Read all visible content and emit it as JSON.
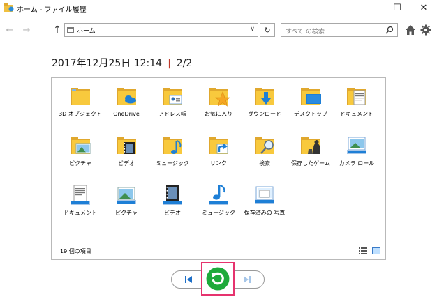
{
  "window": {
    "title": "ホーム - ファイル履歴",
    "minimize": "—",
    "maximize": "☐",
    "close": "✕"
  },
  "nav": {
    "back": "←",
    "forward": "→",
    "up": "↑",
    "address_value": "ホーム",
    "address_dropdown": "∨",
    "refresh": "↻",
    "search_placeholder": "すべて の検索"
  },
  "heading": {
    "datetime": "2017年12月25日 12:14",
    "separator": "|",
    "page": "2/2"
  },
  "items": [
    {
      "label": "3D オブジェクト",
      "icon": "3d-objects-folder-icon"
    },
    {
      "label": "OneDrive",
      "icon": "onedrive-folder-icon"
    },
    {
      "label": "アドレス帳",
      "icon": "contacts-folder-icon"
    },
    {
      "label": "お気に入り",
      "icon": "favorites-folder-icon"
    },
    {
      "label": "ダウンロード",
      "icon": "downloads-folder-icon"
    },
    {
      "label": "デスクトップ",
      "icon": "desktop-folder-icon"
    },
    {
      "label": "ドキュメント",
      "icon": "documents-folder-icon"
    },
    {
      "label": "ピクチャ",
      "icon": "pictures-folder-icon"
    },
    {
      "label": "ビデオ",
      "icon": "videos-folder-icon"
    },
    {
      "label": "ミュージック",
      "icon": "music-folder-icon"
    },
    {
      "label": "リンク",
      "icon": "links-folder-icon"
    },
    {
      "label": "検索",
      "icon": "searches-folder-icon"
    },
    {
      "label": "保存したゲーム",
      "icon": "saved-games-folder-icon"
    },
    {
      "label": "カメラ ロール",
      "icon": "camera-roll-library-icon"
    },
    {
      "label": "ドキュメント",
      "icon": "documents-library-icon"
    },
    {
      "label": "ピクチャ",
      "icon": "pictures-library-icon"
    },
    {
      "label": "ビデオ",
      "icon": "videos-library-icon"
    },
    {
      "label": "ミュージック",
      "icon": "music-library-icon"
    },
    {
      "label": "保存済みの 写真",
      "icon": "saved-pictures-library-icon"
    }
  ],
  "status": {
    "item_count": "19 個の項目"
  },
  "colors": {
    "folder_yellow": "#f8c93d",
    "folder_dark": "#e0a82e",
    "accent_blue": "#1e7fd6",
    "restore_green": "#1faa3b",
    "highlight_pink": "#e6336e",
    "date_separator": "#c0392b"
  }
}
